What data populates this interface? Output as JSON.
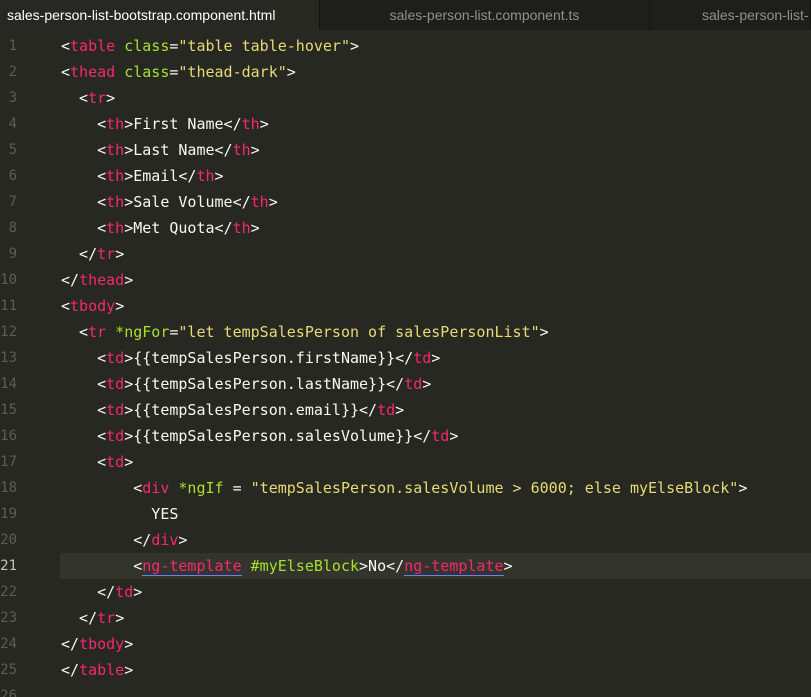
{
  "tabs": [
    {
      "label": "sales-person-list-bootstrap.component.html",
      "active": true
    },
    {
      "label": "sales-person-list.component.ts",
      "active": false
    },
    {
      "label": "sales-person-list-",
      "active": false
    }
  ],
  "editor": {
    "current_line": 21,
    "lines": [
      {
        "n": "1",
        "segs": [
          [
            "p",
            "<"
          ],
          [
            "t",
            "table"
          ],
          [
            "p",
            " "
          ],
          [
            "a",
            "class"
          ],
          [
            "p",
            "="
          ],
          [
            "s",
            "\"table table-hover\""
          ],
          [
            "p",
            ">"
          ]
        ]
      },
      {
        "n": "2",
        "segs": [
          [
            "p",
            "<"
          ],
          [
            "t",
            "thead"
          ],
          [
            "p",
            " "
          ],
          [
            "a",
            "class"
          ],
          [
            "p",
            "="
          ],
          [
            "s",
            "\"thead-dark\""
          ],
          [
            "p",
            ">"
          ]
        ]
      },
      {
        "n": "3",
        "segs": [
          [
            "p",
            "  <"
          ],
          [
            "t",
            "tr"
          ],
          [
            "p",
            ">"
          ]
        ]
      },
      {
        "n": "4",
        "segs": [
          [
            "p",
            "    <"
          ],
          [
            "t",
            "th"
          ],
          [
            "p",
            ">First Name</"
          ],
          [
            "t",
            "th"
          ],
          [
            "p",
            ">"
          ]
        ]
      },
      {
        "n": "5",
        "segs": [
          [
            "p",
            "    <"
          ],
          [
            "t",
            "th"
          ],
          [
            "p",
            ">Last Name</"
          ],
          [
            "t",
            "th"
          ],
          [
            "p",
            ">"
          ]
        ]
      },
      {
        "n": "6",
        "segs": [
          [
            "p",
            "    <"
          ],
          [
            "t",
            "th"
          ],
          [
            "p",
            ">Email</"
          ],
          [
            "t",
            "th"
          ],
          [
            "p",
            ">"
          ]
        ]
      },
      {
        "n": "7",
        "segs": [
          [
            "p",
            "    <"
          ],
          [
            "t",
            "th"
          ],
          [
            "p",
            ">Sale Volume</"
          ],
          [
            "t",
            "th"
          ],
          [
            "p",
            ">"
          ]
        ]
      },
      {
        "n": "8",
        "segs": [
          [
            "p",
            "    <"
          ],
          [
            "t",
            "th"
          ],
          [
            "p",
            ">Met Quota</"
          ],
          [
            "t",
            "th"
          ],
          [
            "p",
            ">"
          ]
        ]
      },
      {
        "n": "9",
        "segs": [
          [
            "p",
            "  </"
          ],
          [
            "t",
            "tr"
          ],
          [
            "p",
            ">"
          ]
        ]
      },
      {
        "n": "10",
        "segs": [
          [
            "p",
            "</"
          ],
          [
            "t",
            "thead"
          ],
          [
            "p",
            ">"
          ]
        ]
      },
      {
        "n": "11",
        "segs": [
          [
            "p",
            "<"
          ],
          [
            "t",
            "tbody"
          ],
          [
            "p",
            ">"
          ]
        ]
      },
      {
        "n": "12",
        "segs": [
          [
            "p",
            "  <"
          ],
          [
            "t",
            "tr"
          ],
          [
            "p",
            " "
          ],
          [
            "a",
            "*ngFor"
          ],
          [
            "p",
            "="
          ],
          [
            "s",
            "\"let tempSalesPerson of salesPersonList\""
          ],
          [
            "p",
            ">"
          ]
        ]
      },
      {
        "n": "13",
        "segs": [
          [
            "p",
            "    <"
          ],
          [
            "t",
            "td"
          ],
          [
            "p",
            ">{{tempSalesPerson.firstName}}</"
          ],
          [
            "t",
            "td"
          ],
          [
            "p",
            ">"
          ]
        ]
      },
      {
        "n": "14",
        "segs": [
          [
            "p",
            "    <"
          ],
          [
            "t",
            "td"
          ],
          [
            "p",
            ">{{tempSalesPerson.lastName}}</"
          ],
          [
            "t",
            "td"
          ],
          [
            "p",
            ">"
          ]
        ]
      },
      {
        "n": "15",
        "segs": [
          [
            "p",
            "    <"
          ],
          [
            "t",
            "td"
          ],
          [
            "p",
            ">{{tempSalesPerson.email}}</"
          ],
          [
            "t",
            "td"
          ],
          [
            "p",
            ">"
          ]
        ]
      },
      {
        "n": "16",
        "segs": [
          [
            "p",
            "    <"
          ],
          [
            "t",
            "td"
          ],
          [
            "p",
            ">{{tempSalesPerson.salesVolume}}</"
          ],
          [
            "t",
            "td"
          ],
          [
            "p",
            ">"
          ]
        ]
      },
      {
        "n": "17",
        "segs": [
          [
            "p",
            "    <"
          ],
          [
            "t",
            "td"
          ],
          [
            "p",
            ">"
          ]
        ]
      },
      {
        "n": "18",
        "segs": [
          [
            "p",
            "        <"
          ],
          [
            "t",
            "div"
          ],
          [
            "p",
            " "
          ],
          [
            "a",
            "*ngIf"
          ],
          [
            "p",
            " = "
          ],
          [
            "s",
            "\"tempSalesPerson.salesVolume > 6000; else myElseBlock\""
          ],
          [
            "p",
            ">"
          ]
        ]
      },
      {
        "n": "19",
        "segs": [
          [
            "p",
            "          YES"
          ]
        ]
      },
      {
        "n": "20",
        "segs": [
          [
            "p",
            "        </"
          ],
          [
            "t",
            "div"
          ],
          [
            "p",
            ">"
          ]
        ]
      },
      {
        "n": "21",
        "segs": [
          [
            "p",
            "        <"
          ],
          [
            "tu",
            "ng-template"
          ],
          [
            "p",
            " "
          ],
          [
            "a",
            "#myElseBlock"
          ],
          [
            "p",
            ">No</"
          ],
          [
            "tu",
            "ng-template"
          ],
          [
            "p",
            ">"
          ]
        ]
      },
      {
        "n": "22",
        "segs": [
          [
            "p",
            "    </"
          ],
          [
            "t",
            "td"
          ],
          [
            "p",
            ">"
          ]
        ]
      },
      {
        "n": "23",
        "segs": [
          [
            "p",
            "  </"
          ],
          [
            "t",
            "tr"
          ],
          [
            "p",
            ">"
          ]
        ]
      },
      {
        "n": "24",
        "segs": [
          [
            "p",
            "</"
          ],
          [
            "t",
            "tbody"
          ],
          [
            "p",
            ">"
          ]
        ]
      },
      {
        "n": "25",
        "segs": [
          [
            "p",
            "</"
          ],
          [
            "t",
            "table"
          ],
          [
            "p",
            ">"
          ]
        ]
      },
      {
        "n": "26",
        "segs": []
      }
    ]
  },
  "colors": {
    "background": "#272822",
    "tab_bar": "#1e1f1c",
    "tag": "#f92672",
    "attribute": "#a6e22e",
    "string": "#e6db74",
    "text": "#f8f8f2",
    "line_number": "#5c5d56",
    "current_line_highlight": "#33342c",
    "underline": "#6b7fff"
  }
}
